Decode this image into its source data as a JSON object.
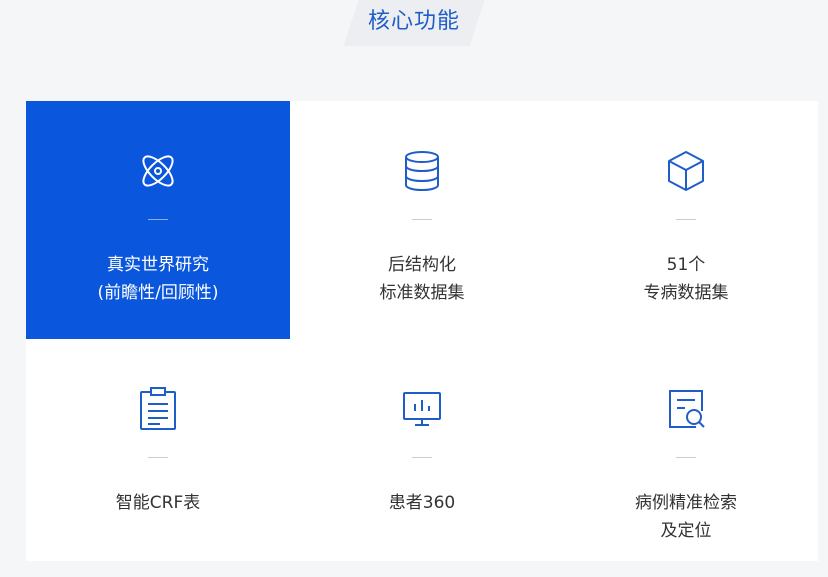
{
  "section": {
    "title": "核心功能"
  },
  "accent_color": "#0a56dc",
  "features": [
    {
      "icon": "atom-icon",
      "line1": "真实世界研究",
      "line2": "(前瞻性/回顾性)",
      "active": true
    },
    {
      "icon": "database-icon",
      "line1": "后结构化",
      "line2": "标准数据集",
      "active": false
    },
    {
      "icon": "cube-icon",
      "line1": "51个",
      "line2": "专病数据集",
      "active": false
    },
    {
      "icon": "clipboard-icon",
      "line1": "智能CRF表",
      "line2": "",
      "active": false
    },
    {
      "icon": "monitor-chart-icon",
      "line1": "患者360",
      "line2": "",
      "active": false
    },
    {
      "icon": "document-search-icon",
      "line1": "病例精准检索",
      "line2": "及定位",
      "active": false
    }
  ]
}
